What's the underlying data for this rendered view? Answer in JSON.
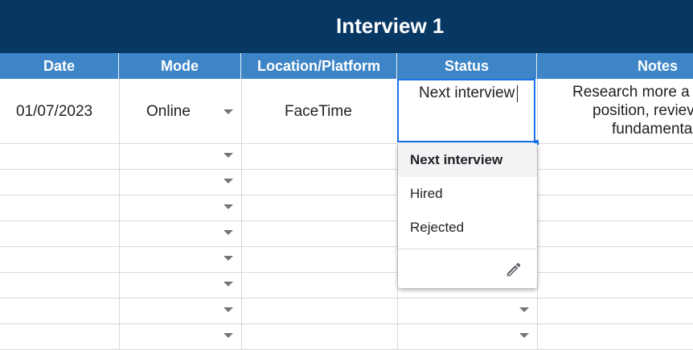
{
  "title": "Interview 1",
  "columns": [
    "Date",
    "Mode",
    "Location/Platform",
    "Status",
    "Notes"
  ],
  "row": {
    "date": "01/07/2023",
    "mode": "Online",
    "location": "FaceTime",
    "status": "Next interview",
    "notes_lines": [
      "Research more a",
      "position, reviev",
      "fundamenta"
    ]
  },
  "dropdown": {
    "options": [
      "Next interview",
      "Hired",
      "Rejected"
    ],
    "selected": "Next interview",
    "edit_icon": "pencil-icon"
  },
  "colors": {
    "banner": "#073763",
    "header": "#3d85c6",
    "selection": "#1a73e8"
  }
}
